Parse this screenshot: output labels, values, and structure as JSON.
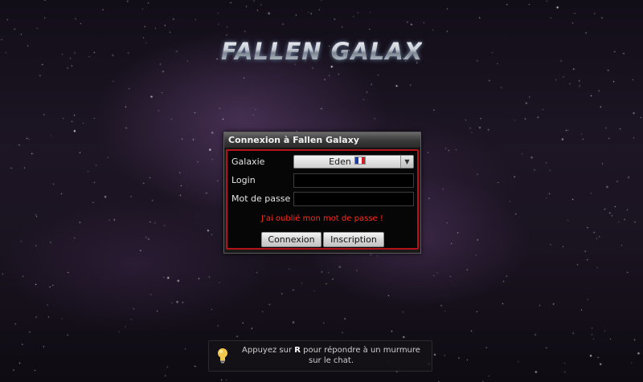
{
  "logo": {
    "text": "FALLEN GALAXY"
  },
  "login": {
    "title": "Connexion à Fallen Galaxy",
    "galaxy_label": "Galaxie",
    "galaxy_value": "Eden",
    "galaxy_flag": "france-flag-icon",
    "login_label": "Login",
    "login_value": "",
    "password_label": "Mot de passe",
    "password_value": "",
    "forgot_password": "J'ai oublié mon mot de passe !",
    "connexion_button": "Connexion",
    "inscription_button": "Inscription"
  },
  "tip": {
    "icon": "lightbulb-icon",
    "text_before": "Appuyez sur ",
    "key": "R",
    "text_after": " pour répondre à un murmure sur le chat."
  },
  "colors": {
    "panel_border": "#b4121a",
    "link_red": "#ff2a1a",
    "background": "#1a1320"
  }
}
